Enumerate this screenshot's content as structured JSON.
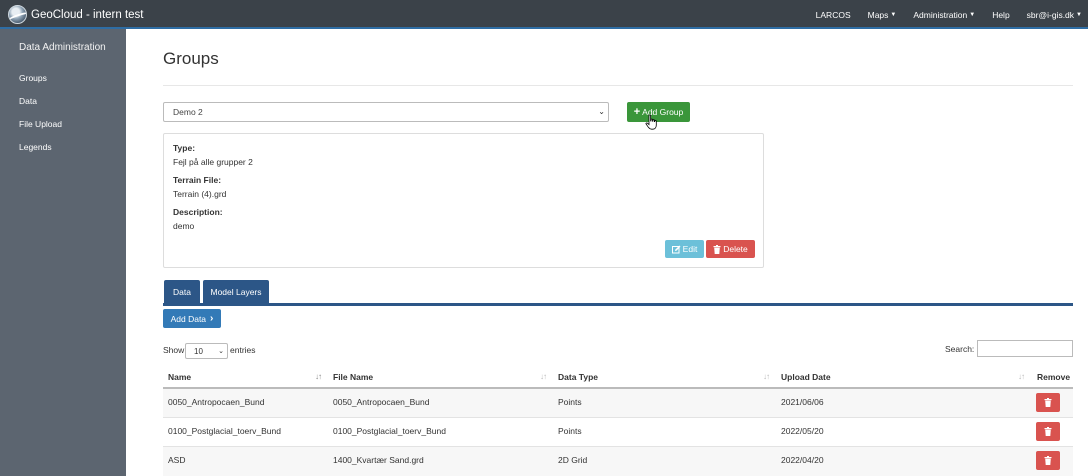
{
  "app": {
    "title": "GeoCloud - intern test"
  },
  "nav": {
    "larcos": "LARCOS",
    "maps": "Maps",
    "administration": "Administration",
    "help": "Help",
    "user": "sbr@i-gis.dk"
  },
  "sidebar": {
    "title": "Data Administration",
    "items": [
      {
        "label": "Groups"
      },
      {
        "label": "Data"
      },
      {
        "label": "File Upload"
      },
      {
        "label": "Legends"
      }
    ]
  },
  "page": {
    "title": "Groups"
  },
  "group_select": {
    "value": "Demo 2"
  },
  "add_group": {
    "label": "Add Group"
  },
  "group_info": {
    "type_label": "Type:",
    "type_value": "Fejl på alle grupper 2",
    "terrain_label": "Terrain File:",
    "terrain_value": "Terrain (4).grd",
    "description_label": "Description:",
    "description_value": "demo",
    "edit_label": "Edit",
    "delete_label": "Delete"
  },
  "tabs": [
    {
      "label": "Data"
    },
    {
      "label": "Model Layers"
    }
  ],
  "add_data": {
    "label": "Add Data"
  },
  "table_controls": {
    "show_label": "Show",
    "entries_value": "10",
    "entries_label": "entries",
    "search_label": "Search:"
  },
  "table": {
    "columns": [
      "Name",
      "File Name",
      "Data Type",
      "Upload Date",
      "Remove"
    ],
    "rows": [
      {
        "name": "0050_Antropocaen_Bund",
        "file": "0050_Antropocaen_Bund",
        "type": "Points",
        "date": "2021/06/06"
      },
      {
        "name": "0100_Postglacial_toerv_Bund",
        "file": "0100_Postglacial_toerv_Bund",
        "type": "Points",
        "date": "2022/05/20"
      },
      {
        "name": "ASD",
        "file": "1400_Kvartær Sand.grd",
        "type": "2D Grid",
        "date": "2022/04/20"
      }
    ]
  },
  "colors": {
    "navbar": "#3b4249",
    "sidebar": "#5c6570",
    "success": "#3a963a",
    "info": "#6cc0d9",
    "danger": "#d9534f",
    "primary_dark": "#2c5687",
    "primary": "#337ab7"
  }
}
